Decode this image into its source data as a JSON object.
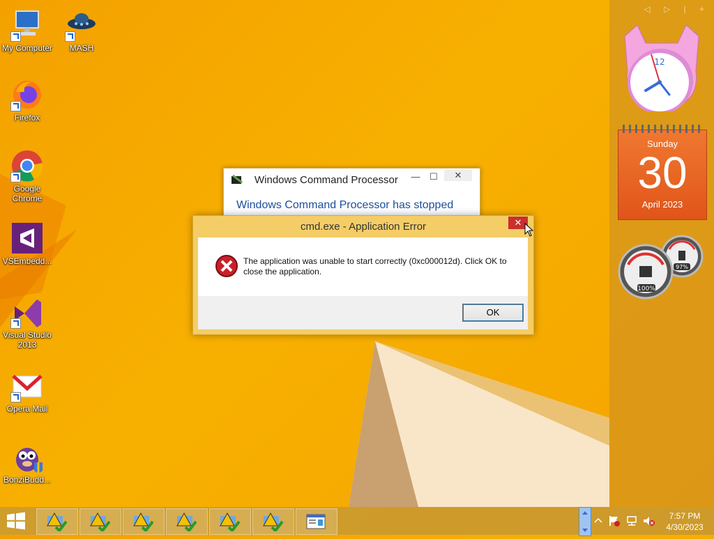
{
  "desktop": {
    "icons": [
      {
        "label": "My Computer",
        "icon": "computer-icon"
      },
      {
        "label": "MASH",
        "icon": "ufo-icon"
      },
      {
        "label": "Firefox",
        "icon": "firefox-icon"
      },
      {
        "label": "Google\nChrome",
        "icon": "chrome-icon"
      },
      {
        "label": "VSEmbedd...",
        "icon": "visual-studio-icon"
      },
      {
        "label": "Visual Studio\n2013",
        "icon": "visual-studio-icon"
      },
      {
        "label": "Opera Mail",
        "icon": "mail-icon"
      },
      {
        "label": "BonziBudd...",
        "icon": "bonzi-icon"
      }
    ]
  },
  "sidebar": {
    "nav": "◁ ▷ | +",
    "calendar": {
      "day": "Sunday",
      "date": "30",
      "month_year": "April 2023"
    },
    "meters": {
      "cpu": "100%",
      "memory": "97%"
    },
    "clock_numeral": "12"
  },
  "back_window": {
    "title": "Windows Command Processor",
    "heading": "Windows Command Processor has stopped",
    "min": "—",
    "max": "☐",
    "close": "✕"
  },
  "dialog": {
    "title": "cmd.exe - Application Error",
    "message": "The application was unable to start correctly (0xc000012d). Click OK to close the application.",
    "ok_label": "OK",
    "close": "✕"
  },
  "taskbar": {
    "buttons": [
      "warning-app-icon",
      "warning-app-icon",
      "warning-app-icon",
      "warning-app-icon",
      "warning-app-icon",
      "warning-app-icon",
      "window-app-icon"
    ],
    "time": "7:57 PM",
    "date": "4/30/2023"
  },
  "colors": {
    "accent_orange": "#e0551a",
    "error_red": "#c9302c",
    "link_blue": "#1b4f9c"
  }
}
